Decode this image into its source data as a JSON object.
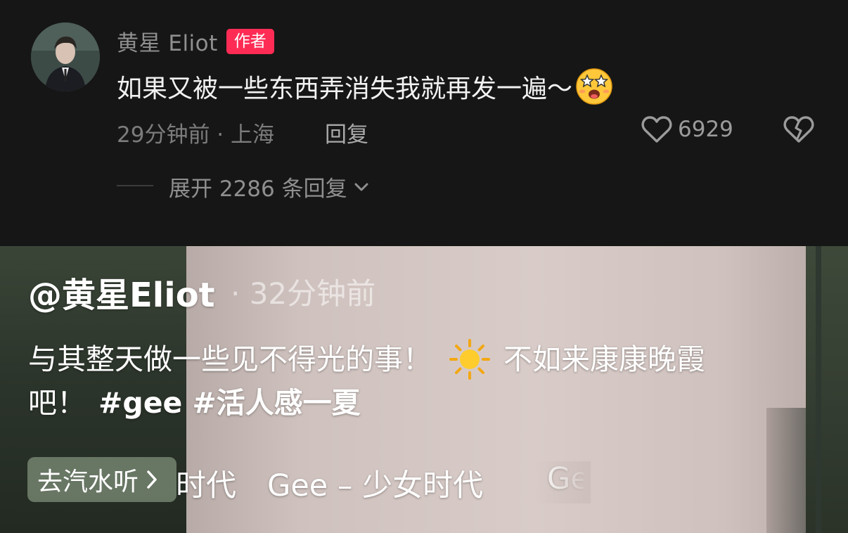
{
  "comment": {
    "author": "黄星 Eliot",
    "author_badge": "作者",
    "text": "如果又被一些东西弄消失我就再发一遍～",
    "time_location": "29分钟前 · 上海",
    "reply_label": "回复",
    "like_count": "6929",
    "expand_label": "展开 2286 条回复"
  },
  "video": {
    "author": "@黄星Eliot",
    "time": "· 32分钟前",
    "caption_line1_a": "与其整天做一些见不得光的事！",
    "caption_line1_b": "不如来康康晚霞",
    "caption_line2_prefix": "吧！",
    "hashtags": [
      "#gee",
      "#活人感一夏"
    ],
    "soda_button_label": "去汽水听",
    "music_text": "Gee – 少女时代",
    "music_partial_left": "时代",
    "music_partial_right": "Ge"
  },
  "icons": {
    "heart": "heart-outline-icon",
    "dislike": "broken-heart-icon",
    "chevron": "chevron-down-icon",
    "emoji": "starry-eyes-emoji-icon",
    "sun": "sun-emoji-icon",
    "arrow": "chevron-right-icon"
  },
  "colors": {
    "badge": "#fe2c55",
    "background": "#161616"
  }
}
